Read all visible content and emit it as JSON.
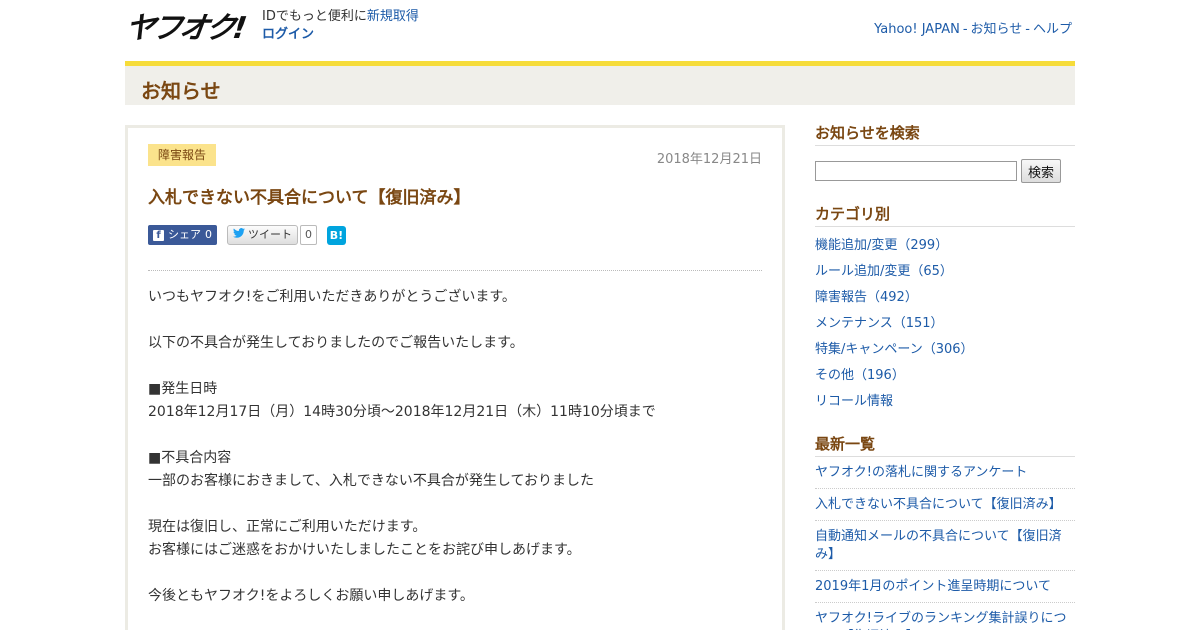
{
  "header": {
    "logo_text": "ヤフオク!",
    "id_text": "IDでもっと便利に",
    "signup_link": "新規取得",
    "login_link": "ログイン",
    "links": [
      "Yahoo! JAPAN",
      "お知らせ",
      "ヘルプ"
    ],
    "link_separator": "-"
  },
  "page": {
    "title": "お知らせ"
  },
  "article": {
    "category": "障害報告",
    "date": "2018年12月21日",
    "title": "入札できない不具合について【復旧済み】",
    "share": {
      "facebook_icon": "f",
      "facebook_label": "シェア",
      "facebook_count": "0",
      "tweet_label": "ツイート",
      "tweet_count": "0",
      "hatena_label": "B!"
    },
    "paragraphs": [
      "いつもヤフオク!をご利用いただきありがとうございます。",
      "",
      "以下の不具合が発生しておりましたのでご報告いたします。",
      "",
      "■発生日時",
      "2018年12月17日（月）14時30分頃～2018年12月21日（木）11時10分頃まで",
      "",
      "■不具合内容",
      "一部のお客様におきまして、入札できない不具合が発生しておりました",
      "",
      "現在は復旧し、正常にご利用いただけます。",
      "お客様にはご迷惑をおかけいたしましたことをお詫び申しあげます。",
      "",
      "今後ともヤフオク!をよろしくお願い申しあげます。"
    ]
  },
  "sidebar": {
    "search": {
      "heading": "お知らせを検索",
      "value": "",
      "button": "検索"
    },
    "categories": {
      "heading": "カテゴリ別",
      "items": [
        "機能追加/変更（299）",
        "ルール追加/変更（65）",
        "障害報告（492）",
        "メンテナンス（151）",
        "特集/キャンペーン（306）",
        "その他（196）",
        "リコール情報"
      ]
    },
    "latest": {
      "heading": "最新一覧",
      "items": [
        "ヤフオク!の落札に関するアンケート",
        "入札できない不具合について【復旧済み】",
        "自動通知メールの不具合について【復旧済み】",
        "2019年1月のポイント進呈時期について",
        "ヤフオク!ライブのランキング集計誤りについて【復旧済み】"
      ]
    }
  },
  "colors": {
    "accent_yellow": "#f6dc3a",
    "title_brown": "#7a4712",
    "link_blue": "#1d5ba8",
    "badge_bg": "#fbe38c"
  }
}
